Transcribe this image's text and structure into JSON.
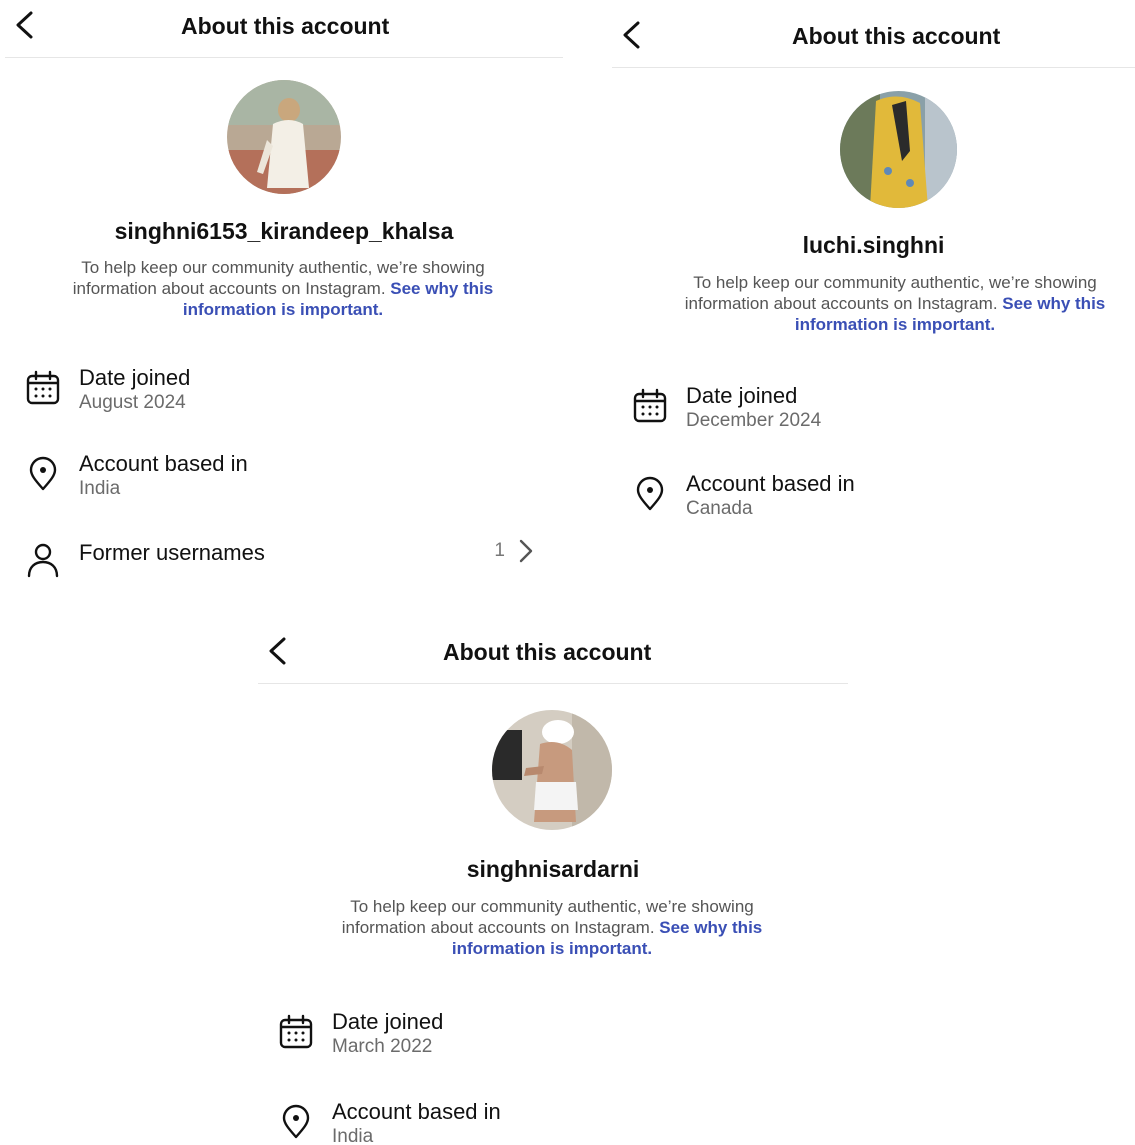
{
  "panels": [
    {
      "header_title": "About this account",
      "username": "singhni6153_kirandeep_khalsa",
      "info_text": "To help keep our community authentic, we’re showing information about accounts on Instagram. ",
      "info_link": "See why this information is important.",
      "date_joined_label": "Date joined",
      "date_joined_value": "August 2024",
      "based_in_label": "Account based in",
      "based_in_value": "India",
      "former_usernames_label": "Former usernames",
      "former_usernames_count": "1"
    },
    {
      "header_title": "About this account",
      "username": "luchi.singhni",
      "info_text": "To help keep our community authentic, we’re showing information about accounts on Instagram. ",
      "info_link": "See why this information is important.",
      "date_joined_label": "Date joined",
      "date_joined_value": "December 2024",
      "based_in_label": "Account based in",
      "based_in_value": "Canada"
    },
    {
      "header_title": "About this account",
      "username": "singhnisardarni",
      "info_text": "To help keep our community authentic, we’re showing information about accounts on Instagram. ",
      "info_link": "See why this information is important.",
      "date_joined_label": "Date joined",
      "date_joined_value": "March 2022",
      "based_in_label": "Account based in",
      "based_in_value": "India"
    }
  ],
  "icons": {
    "back": "chevron-left-icon",
    "date_joined": "calendar-icon",
    "based_in": "location-pin-icon",
    "former_usernames": "person-icon",
    "forward": "chevron-right-icon"
  },
  "colors": {
    "link": "#3a4fb5",
    "text_primary": "#111111",
    "text_secondary": "#6b6b6b",
    "divider": "#e6e6e6"
  }
}
